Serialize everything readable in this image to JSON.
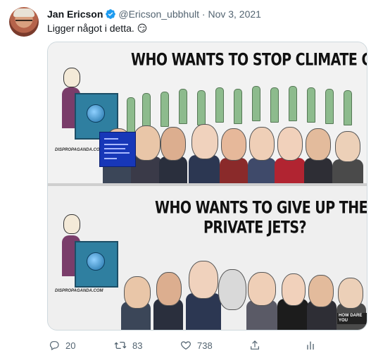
{
  "tweet": {
    "author_name": "Jan Ericson",
    "handle": "@Ericson_ubbhult",
    "separator": "·",
    "date": "Nov 3, 2021",
    "text": "Ligger något i detta. 😏"
  },
  "meme": {
    "caption_top": "WHO WANTS TO STOP CLIMATE CHANGE?",
    "caption_bottom_line1": "WHO WANTS TO GIVE UP THEIR",
    "caption_bottom_line2": "PRIVATE JETS?",
    "watermark": "DISPROPAGANDA.COM",
    "badge": "HOW DARE YOU"
  },
  "actions": {
    "replies": "20",
    "retweets": "83",
    "likes": "738"
  },
  "colors": {
    "text_primary": "#0f1419",
    "text_secondary": "#536471",
    "verified_blue": "#1d9bf0",
    "border": "#cfd9de"
  },
  "icons": [
    "verified-badge-icon",
    "reply-icon",
    "retweet-icon",
    "like-icon",
    "share-icon",
    "analytics-icon"
  ]
}
